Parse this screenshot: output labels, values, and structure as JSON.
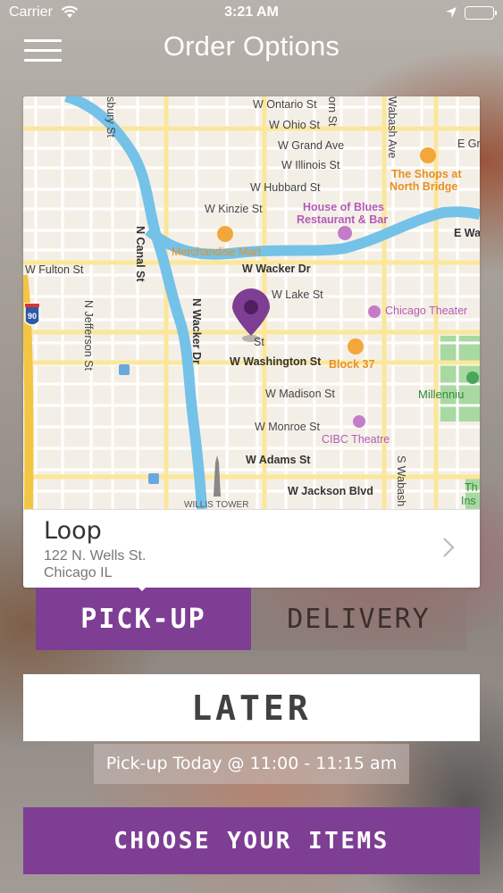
{
  "status_bar": {
    "carrier": "Carrier",
    "time": "3:21 AM",
    "icons": [
      "wifi-icon",
      "location-arrow-icon",
      "battery-icon"
    ]
  },
  "nav": {
    "title": "Order Options",
    "menu_icon": "hamburger-menu-icon"
  },
  "map": {
    "streets": [
      "W Ontario St",
      "W Ohio St",
      "W Grand Ave",
      "W Illinois St",
      "W Hubbard St",
      "W Kinzie St",
      "W Wacker Dr",
      "W Lake St",
      "W Fulton St",
      "W Washington St",
      "W Madison St",
      "W Monroe St",
      "W Adams St",
      "W Jackson Blvd",
      "N Canal St",
      "N Wacker Dr",
      "N Jefferson St",
      "Wabash Ave",
      "S Wabash",
      "E Wa",
      "E Gra",
      "sbury St",
      "orn St",
      "St"
    ],
    "places": {
      "merchandise_mart": "Merchandise Mart",
      "house_of_blues_1": "House of Blues",
      "house_of_blues_2": "Restaurant & Bar",
      "shops_1": "The Shops at",
      "shops_2": "North Bridge",
      "chicago_theater": "Chicago Theater",
      "block37": "Block 37",
      "millennium": "Millenniu",
      "cibc": "CIBC Theatre",
      "willis": "WILLIS TOWER",
      "th": "Th",
      "ins": "Ins"
    },
    "highway_shield": "90",
    "colors": {
      "river": "#74c2e8",
      "pin": "#7e3e93",
      "park": "#9fd59b"
    }
  },
  "location": {
    "name": "Loop",
    "address": "122 N. Wells St.",
    "city": "Chicago IL"
  },
  "mode_toggle": {
    "pickup_label": "PICK-UP",
    "delivery_label": "DELIVERY",
    "selected": "pickup"
  },
  "later_label": "LATER",
  "pickup_time": "Pick-up Today @ 11:00 - 11:15 am",
  "cta_label": "CHOOSE YOUR ITEMS",
  "accent_color": "#7e3e93"
}
